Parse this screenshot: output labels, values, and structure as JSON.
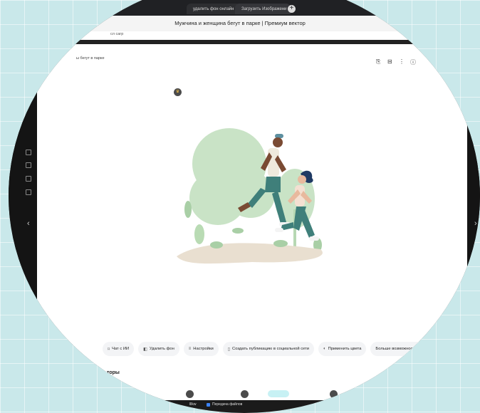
{
  "browser": {
    "tabs": [
      {
        "label": "удалить фон онлайн — S",
        "favicon_color": "#e94b4b"
      },
      {
        "label": "Загрузить Изображени",
        "favicon_color": "#f0b429"
      }
    ],
    "new_tab_symbol": "+"
  },
  "page": {
    "title": "Мужчина и женщина бегут в парке | Премиум вектор",
    "address_fragment": "сл сагр",
    "breadcrumb": "ы бегут в парке"
  },
  "toolbar_icons": [
    "bookmark-add-icon",
    "save-to-collection-icon",
    "more-options-icon",
    "info-icon"
  ],
  "ai_actions": [
    {
      "label": "Чат с ИИ",
      "icon": "chat-icon",
      "glyph": "⌑"
    },
    {
      "label": "Удалить фон",
      "icon": "remove-background-icon",
      "glyph": "◧"
    },
    {
      "label": "Настройки",
      "icon": "settings-icon",
      "glyph": "≡"
    },
    {
      "label": "Создать публикацию в социальной сети",
      "icon": "social-post-icon",
      "glyph": "▯"
    },
    {
      "label": "Применить цвета",
      "icon": "palette-icon",
      "glyph": "◐"
    },
    {
      "label": "Больше возможностей с ИИ",
      "icon": "ai-more-icon",
      "glyph": ""
    }
  ],
  "section": {
    "title": "торы"
  },
  "taskbar": {
    "item_left": "lllkw",
    "item_right": "Передача файлов"
  },
  "colors": {
    "premium_crown": "#f5c24a",
    "illustration_green": "#c9e3c6",
    "jogger_teal": "#3f7f7a"
  }
}
